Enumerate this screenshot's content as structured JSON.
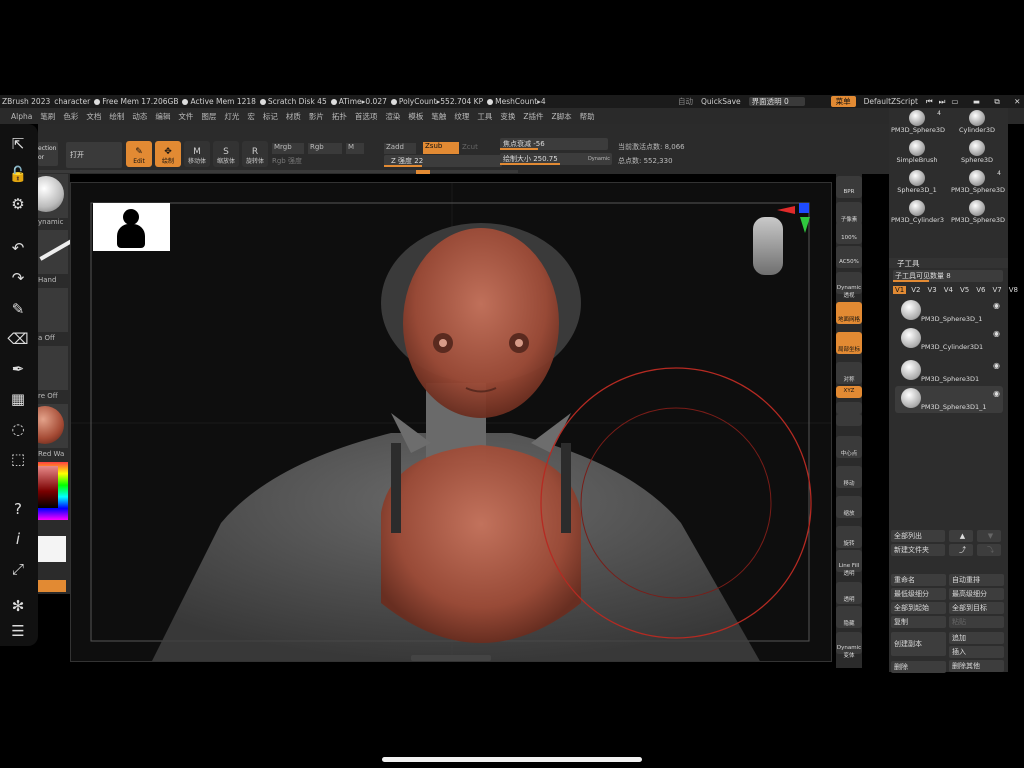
{
  "status_bar": {
    "app": "ZBrush 2023",
    "file": "character",
    "free_mem": "Free Mem 17.206GB",
    "active_mem": "Active Mem 1218",
    "scratch_disk": "Scratch Disk 45",
    "atime": "ATime▸0.027",
    "polycount": "PolyCount▸552.704 KP",
    "meshcount": "MeshCount▸4",
    "auto": "自动",
    "quicksave": "QuickSave",
    "transparency_label": "界面透明 0",
    "menu": "菜单",
    "script": "DefaultZScript"
  },
  "menubar": [
    "Alpha",
    "笔刷",
    "色彩",
    "文档",
    "绘制",
    "动态",
    "编辑",
    "文件",
    "图层",
    "灯光",
    "宏",
    "标记",
    "材质",
    "影片",
    "拓扑",
    "首选项",
    "渲染",
    "模板",
    "笔触",
    "纹理",
    "工具",
    "变换",
    "Z插件",
    "Z脚本",
    "帮助"
  ],
  "toolbar": {
    "projection": "ection",
    "projection2": "or",
    "spotlight": "打开",
    "edit": "Edit",
    "draw": "绘制",
    "move": "移动体",
    "scale": "缩放体",
    "rotate": "旋转体",
    "mrgb": "Mrgb",
    "rgb": "Rgb",
    "m": "M",
    "rgb_intensity": "Rgb 强度",
    "zadd": "Zadd",
    "zsub": "Zsub",
    "zcut": "Zcut",
    "z_intensity": "Z 强度 22",
    "focal_shift": "焦点衰减 -56",
    "draw_size": "绘制大小 250.75",
    "dynamic": "Dynamic",
    "active_points": "当前激活点数: 8,066",
    "total_points": "总点数: 552,330"
  },
  "shelf": {
    "dynamic": "ynamic",
    "hand": "Hand",
    "alpha_off": "a Off",
    "texture_off": "re Off",
    "material": "Red Wa"
  },
  "right_shelf": [
    "BPR",
    "子像素",
    "100%",
    "AC50%",
    "Dynamic 透视",
    "地面网格",
    "局部坐标",
    "对称",
    "XYZ",
    "",
    "",
    "中心点",
    "移动",
    "缩放",
    "旋转",
    "Line Fill 透明",
    "透明",
    "隐藏",
    "Dynamic 变体"
  ],
  "right_panel": {
    "tools": [
      {
        "name": "PM3D_Sphere3D",
        "count": "4"
      },
      {
        "name": "Cylinder3D"
      },
      {
        "name": "SimpleBrush"
      },
      {
        "name": "Sphere3D"
      },
      {
        "name": "Sphere3D_1"
      },
      {
        "name": "PM3D_Sphere3D",
        "count": "4"
      },
      {
        "name": "PM3D_Cylinder3"
      },
      {
        "name": "PM3D_Sphere3D"
      }
    ],
    "subtool_title": "子工具",
    "visible_count": "子工具可见数量 8",
    "v_tabs": [
      "V1",
      "V2",
      "V3",
      "V4",
      "V5",
      "V6",
      "V7",
      "V8"
    ],
    "subtools": [
      "PM3D_Sphere3D_1",
      "PM3D_Cylinder3D1",
      "PM3D_Sphere3D1",
      "PM3D_Sphere3D1_1"
    ],
    "list_all": "全部列出",
    "new_folder": "新建文件夹",
    "rename": "重命名",
    "auto_reorder": "自动重排",
    "lowest_subdiv": "最低级细分",
    "highest_subdiv": "最高级细分",
    "all_to_start": "全部到起始",
    "all_to_target": "全部到目标",
    "duplicate": "复制",
    "paste": "粘贴",
    "create_copy": "创建副本",
    "append": "追加",
    "insert": "插入",
    "delete": "删除",
    "delete_others": "删除其他"
  },
  "colors": {
    "accent": "#e28a33",
    "panel": "#2d2d2d",
    "canvas": "#0e0e0e"
  }
}
